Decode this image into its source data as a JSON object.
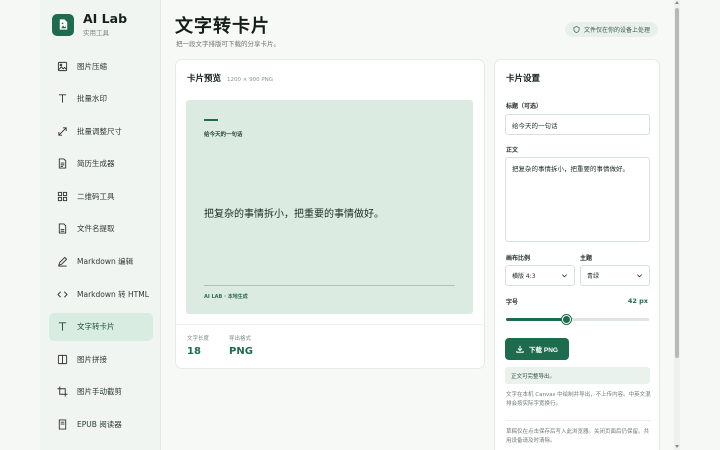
{
  "brand": {
    "title": "AI Lab",
    "subtitle": "实用工具",
    "logo_icon": "document-image-icon"
  },
  "sidebar": {
    "items": [
      {
        "label": "图片压缩",
        "icon": "image-icon"
      },
      {
        "label": "批量水印",
        "icon": "text-t-icon"
      },
      {
        "label": "批量调整尺寸",
        "icon": "resize-arrows-icon"
      },
      {
        "label": "简历生成器",
        "icon": "document-icon"
      },
      {
        "label": "二维码工具",
        "icon": "grid-icon"
      },
      {
        "label": "文件名提取",
        "icon": "file-icon"
      },
      {
        "label": "Markdown 编辑",
        "icon": "pen-icon"
      },
      {
        "label": "Markdown 转 HTML",
        "icon": "code-brackets-icon"
      },
      {
        "label": "文字转卡片",
        "icon": "text-t-icon",
        "active": true
      },
      {
        "label": "图片拼接",
        "icon": "book-icon"
      },
      {
        "label": "图片手动截剪",
        "icon": "crop-icon"
      },
      {
        "label": "EPUB 阅读器",
        "icon": "book-page-icon"
      }
    ]
  },
  "header": {
    "title": "文字转卡片",
    "subtitle": "把一段文字排版可下载的分享卡片。",
    "privacy_badge": "文件仅在你的设备上处理"
  },
  "preview": {
    "title": "卡片预览",
    "dimensions": "1200 × 900 PNG",
    "card": {
      "label": "给今天的一句话",
      "body": "把复杂的事情拆小，把重要的事情做好。",
      "footer": "AI LAB · 本地生成"
    },
    "stats": [
      {
        "label": "文字长度",
        "value": "18"
      },
      {
        "label": "导出格式",
        "value": "PNG"
      }
    ]
  },
  "settings": {
    "title": "卡片设置",
    "title_field_label": "标题（可选）",
    "title_field_value": "给今天的一句话",
    "body_label": "正文",
    "body_value": "把复杂的事情拆小，把重要的事情做好。",
    "ratio_label": "画布比例",
    "ratio_value": "横版 4:3",
    "theme_label": "主题",
    "theme_value": "青绿",
    "size_label": "字号",
    "size_value": "42 px",
    "size_fraction": 0.42,
    "download_label": "下载 PNG",
    "status": "正文可完整导出。",
    "note1": "文字在本机 Canvas 中绘制并导出，不上传内容。中英文混排会按实际字宽换行。",
    "note2": "草稿仅在点击保存后写入此浏览器。关闭页面后仍保留。共用设备请及时清除。"
  },
  "colors": {
    "accent": "#1e6b4e",
    "card_bg": "#dcebe2",
    "active_nav": "#d9ece1"
  }
}
